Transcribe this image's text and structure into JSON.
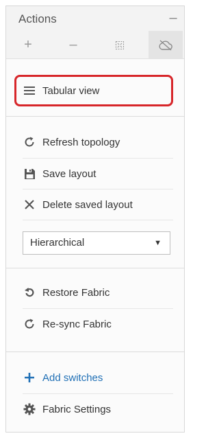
{
  "panel": {
    "title": "Actions",
    "collapse_label": "–"
  },
  "toolbar": {
    "zoom_in": "+",
    "zoom_out": "–"
  },
  "items": {
    "tabular_view": "Tabular view",
    "refresh_topology": "Refresh topology",
    "save_layout": "Save layout",
    "delete_saved_layout": "Delete saved layout",
    "restore_fabric": "Restore Fabric",
    "resync_fabric": "Re-sync Fabric",
    "add_switches": "Add switches",
    "fabric_settings": "Fabric Settings"
  },
  "layout_select": {
    "selected": "Hierarchical",
    "caret": "▼"
  },
  "colors": {
    "highlight": "#d7262a",
    "add_icon": "#1f6fb5"
  }
}
